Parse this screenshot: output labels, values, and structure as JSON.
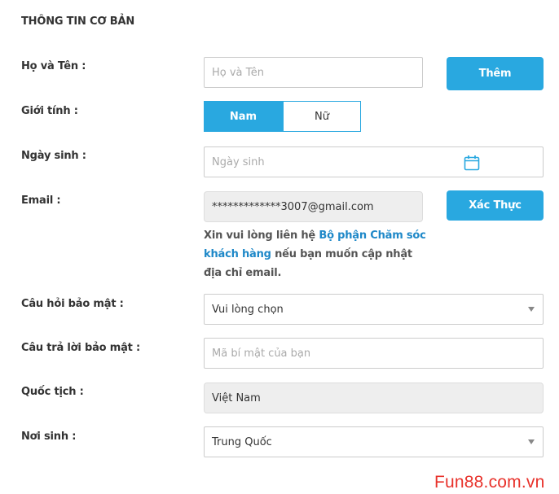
{
  "section": {
    "title": "THÔNG TIN CƠ BẢN"
  },
  "fullname": {
    "label": "Họ và Tên  :",
    "placeholder": "Họ và Tên",
    "button": "Thêm"
  },
  "gender": {
    "label": "Giới tính  :",
    "options": [
      "Nam",
      "Nữ"
    ],
    "selected": "Nam"
  },
  "birthday": {
    "label": "Ngày sinh  :",
    "placeholder": "Ngày sinh",
    "icon": "calendar-icon"
  },
  "email": {
    "label": "Email  :",
    "value": "*************3007@gmail.com",
    "button": "Xác Thực",
    "note_prefix": "Xin vui lòng liên hệ ",
    "note_link": "Bộ phận Chăm sóc khách hàng",
    "note_suffix": " nếu bạn muốn cập nhật địa chỉ email."
  },
  "security_question": {
    "label": "Câu hỏi bảo mật  :",
    "value": "Vui lòng chọn"
  },
  "security_answer": {
    "label": "Câu trả lời bảo mật  :",
    "placeholder": "Mã bí mật của bạn"
  },
  "nationality": {
    "label": "Quốc tịch  :",
    "value": "Việt Nam"
  },
  "birthplace": {
    "label": "Nơi sinh  :",
    "value": "Trung Quốc"
  },
  "watermark": "Fun88.com.vn",
  "colors": {
    "accent": "#29a8e0",
    "link": "#1e88c8",
    "watermark": "#e8322b"
  }
}
